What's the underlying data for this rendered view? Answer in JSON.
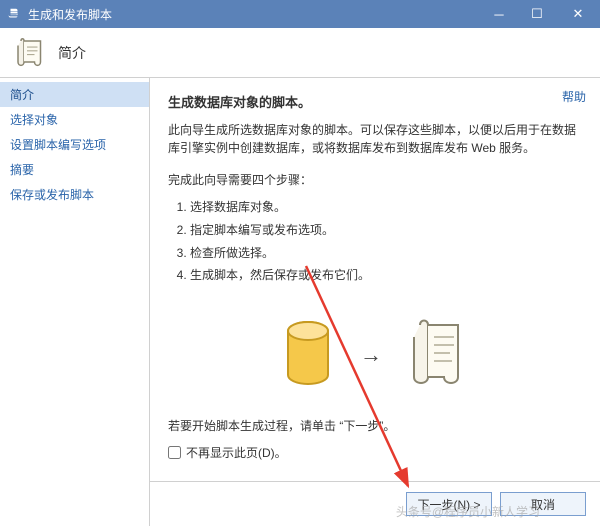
{
  "titlebar": {
    "title": "生成和发布脚本"
  },
  "header": {
    "title": "简介"
  },
  "sidebar": {
    "items": [
      {
        "label": "简介",
        "active": true
      },
      {
        "label": "选择对象"
      },
      {
        "label": "设置脚本编写选项"
      },
      {
        "label": "摘要"
      },
      {
        "label": "保存或发布脚本"
      }
    ]
  },
  "content": {
    "help": "帮助",
    "title": "生成数据库对象的脚本。",
    "para": "此向导生成所选数据库对象的脚本。可以保存这些脚本，以便以后用于在数据库引擎实例中创建数据库，或将数据库发布到数据库发布 Web 服务。",
    "steps_intro": "完成此向导需要四个步骤：",
    "steps": [
      "选择数据库对象。",
      "指定脚本编写或发布选项。",
      "检查所做选择。",
      "生成脚本，然后保存或发布它们。"
    ],
    "start_text": "若要开始脚本生成过程，请单击 “下一步”。",
    "checkbox_label": "不再显示此页(D)。"
  },
  "footer": {
    "next": "下一步(N) >",
    "cancel": "取消"
  },
  "watermark": "头条号@程序员小新人学习"
}
